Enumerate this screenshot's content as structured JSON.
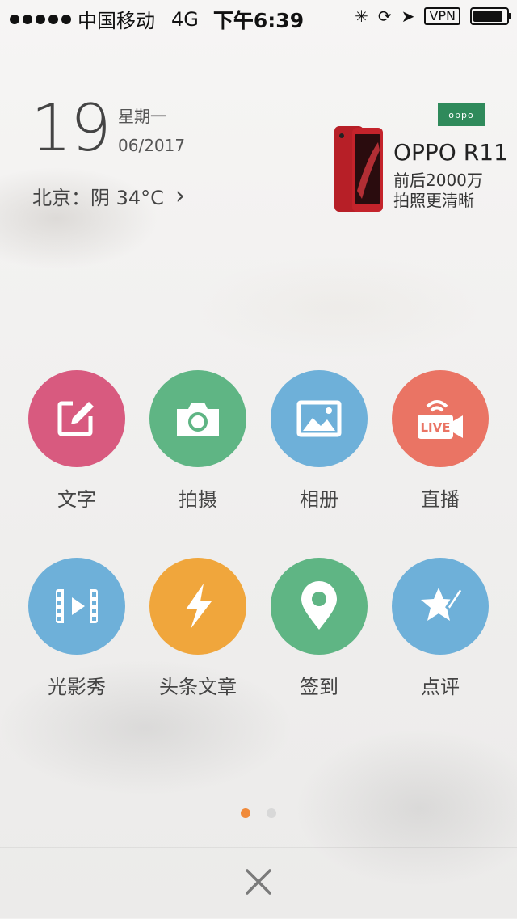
{
  "status_bar": {
    "carrier": "中国移动",
    "network": "4G",
    "time": "下午6:39",
    "vpn": "VPN",
    "battery_level": 0.9
  },
  "date": {
    "day": "19",
    "weekday": "星期一",
    "month_year": "06/2017"
  },
  "weather": {
    "text": "北京：阴 34°C"
  },
  "ad": {
    "brand": "oppo",
    "title": "OPPO R11",
    "line1": "前后2000万",
    "line2": "拍照更清晰",
    "colors": {
      "brand_bg": "#2f8a5b",
      "phone": "#c4232b"
    }
  },
  "actions": [
    {
      "label": "文字",
      "icon": "edit-icon",
      "color": "#d85a7f"
    },
    {
      "label": "拍摄",
      "icon": "camera-icon",
      "color": "#5fb584"
    },
    {
      "label": "相册",
      "icon": "photo-album-icon",
      "color": "#6eb0d9"
    },
    {
      "label": "直播",
      "icon": "live-icon",
      "color": "#ea7464"
    },
    {
      "label": "光影秀",
      "icon": "video-icon",
      "color": "#6eb0d9"
    },
    {
      "label": "头条文章",
      "icon": "lightning-icon",
      "color": "#f0a63c"
    },
    {
      "label": "签到",
      "icon": "location-pin-icon",
      "color": "#5fb584"
    },
    {
      "label": "点评",
      "icon": "star-pen-icon",
      "color": "#6eb0d9"
    }
  ],
  "pagination": {
    "active_color": "#f08a3a",
    "inactive_color": "#d8d8d8",
    "current": 1,
    "total": 2
  }
}
